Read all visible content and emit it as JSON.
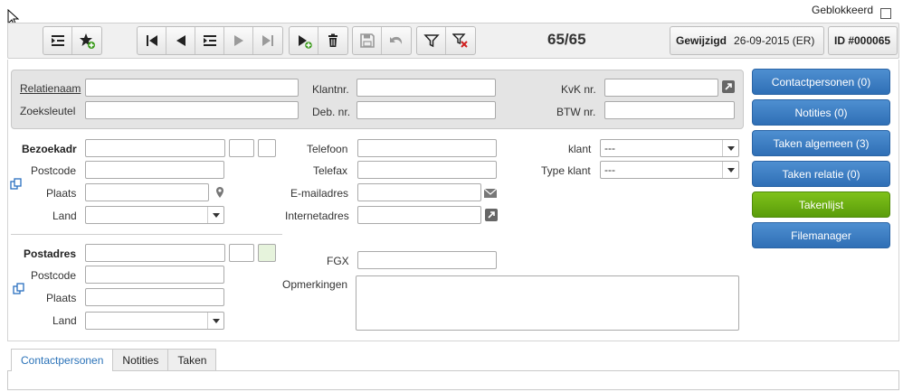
{
  "header": {
    "blocked_label": "Geblokkeerd"
  },
  "toolbar": {
    "counter": "65/65",
    "modified_label": "Gewijzigd",
    "modified_value": "26-09-2015 (ER)",
    "id_label": "ID #000065"
  },
  "relation": {
    "name_label": "Relatienaam",
    "searchkey_label": "Zoeksleutel",
    "customer_no_label": "Klantnr.",
    "debtor_no_label": "Deb. nr.",
    "kvk_label": "KvK nr.",
    "vat_label": "BTW nr."
  },
  "visit_address": {
    "title": "Bezoekadr",
    "postcode_label": "Postcode",
    "city_label": "Plaats",
    "country_label": "Land"
  },
  "postal_address": {
    "title": "Postadres",
    "postcode_label": "Postcode",
    "city_label": "Plaats",
    "country_label": "Land"
  },
  "contact": {
    "phone_label": "Telefoon",
    "fax_label": "Telefax",
    "email_label": "E-mailadres",
    "website_label": "Internetadres",
    "fgx_label": "FGX",
    "remarks_label": "Opmerkingen"
  },
  "classification": {
    "customer_label": "klant",
    "customer_value": "---",
    "type_label": "Type klant",
    "type_value": "---"
  },
  "side_buttons": {
    "contacts": "Contactpersonen (0)",
    "notes": "Notities (0)",
    "tasks_general": "Taken algemeen (3)",
    "tasks_relation": "Taken relatie (0)",
    "tasklist": "Takenlijst",
    "filemanager": "Filemanager"
  },
  "tabs": [
    "Contactpersonen",
    "Notities",
    "Taken"
  ],
  "colors": {
    "accent_blue": "#2f6fb6",
    "accent_green": "#5a9c0a",
    "tab_active": "#2a72b8"
  }
}
